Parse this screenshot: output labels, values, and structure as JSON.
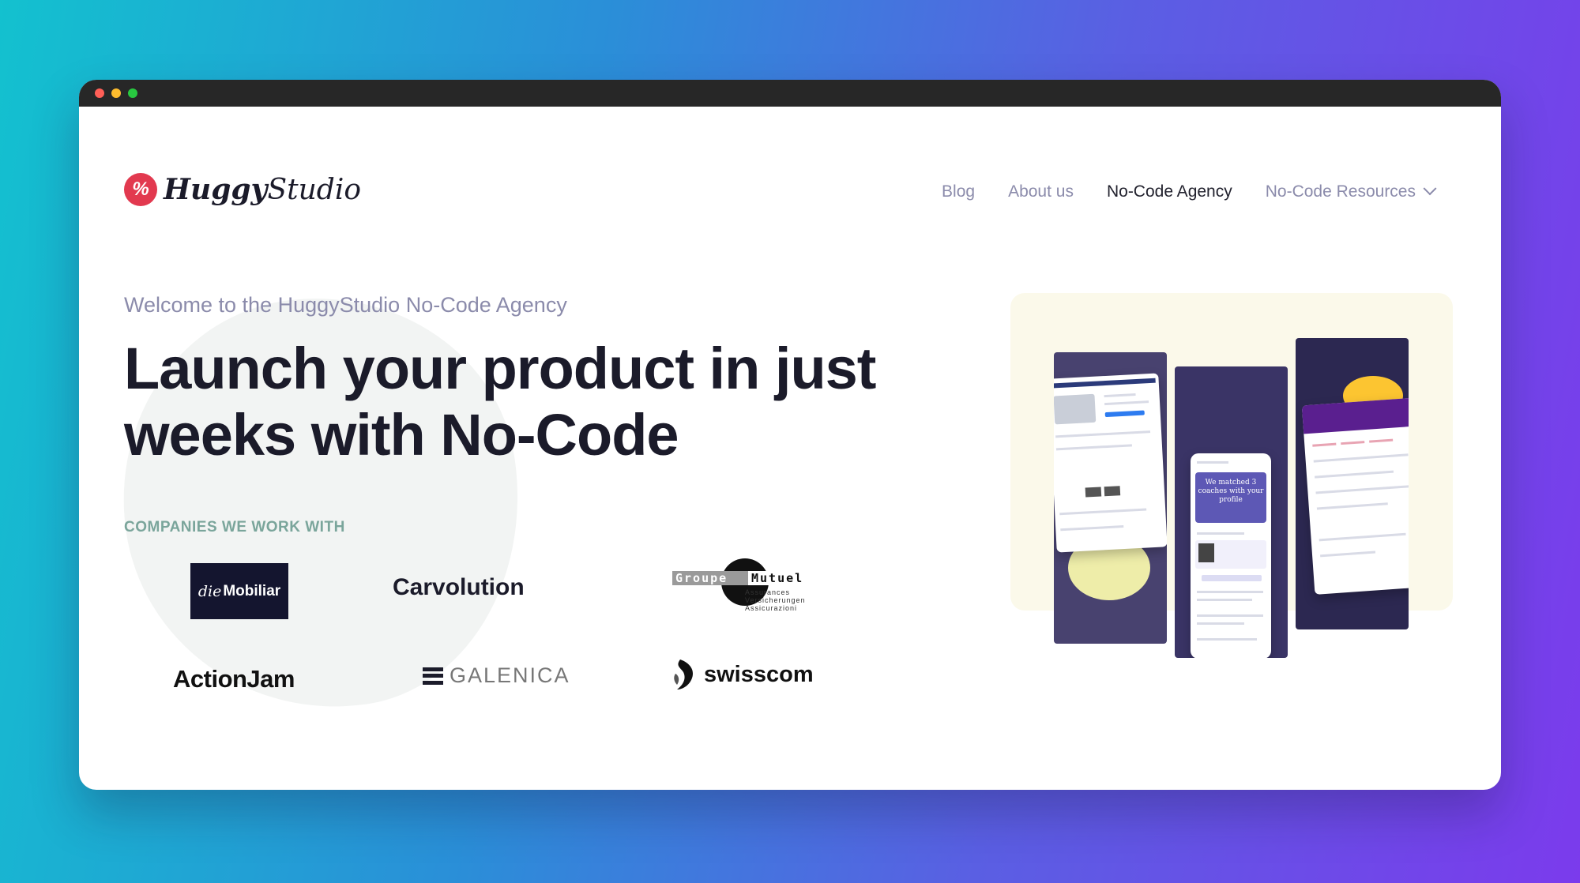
{
  "nav": {
    "logo_primary": "Huggy",
    "logo_secondary": "Studio",
    "links": [
      {
        "label": "Blog"
      },
      {
        "label": "About us"
      },
      {
        "label": "No-Code Agency"
      },
      {
        "label": "No-Code Resources"
      }
    ]
  },
  "hero": {
    "eyebrow": "Welcome to the HuggyStudio No-Code Agency",
    "headline": "Launch your product in just weeks with No-Code"
  },
  "companies": {
    "title": "COMPANIES WE WORK WITH",
    "mobiliar_die": "die",
    "mobiliar_name": "Mobiliar",
    "carvolution": "Carvolution",
    "groupe_mutuel_line1": "Groupe",
    "groupe_mutuel_line2": "Mutuel",
    "groupe_mutuel_tag1": "Assurances",
    "groupe_mutuel_tag2": "Versicherungen",
    "groupe_mutuel_tag3": "Assicurazioni",
    "actionjam": "ActionJam",
    "galenica": "GALENICA",
    "swisscom": "swisscom"
  },
  "showcase": {
    "coach_card": "We matched 3 coaches with your profile"
  },
  "colors": {
    "accent": "#e2394f",
    "nav_text": "#8b8bab",
    "heading": "#1b1b2a",
    "companies_title": "#7aa59b",
    "showcase_bg": "#fbf9ea"
  }
}
